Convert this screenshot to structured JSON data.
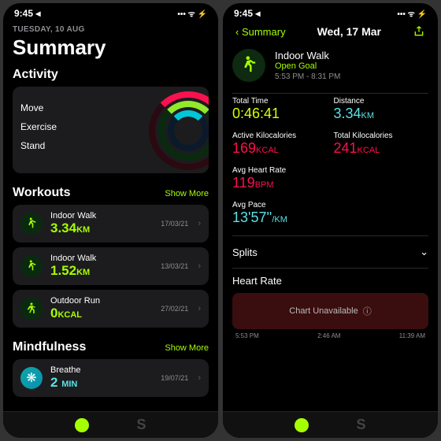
{
  "status": {
    "time": "9:45",
    "loc": "◂",
    "icons": "•••  ᯤ ⚡"
  },
  "left": {
    "date": "TUESDAY, 10 AUG",
    "title": "Summary",
    "activity": {
      "heading": "Activity",
      "labels": [
        "Move",
        "Exercise",
        "Stand"
      ]
    },
    "workouts": {
      "heading": "Workouts",
      "more": "Show More",
      "items": [
        {
          "name": "Indoor Walk",
          "val": "3.34",
          "unit": "KM",
          "date": "17/03/21"
        },
        {
          "name": "Indoor Walk",
          "val": "1.52",
          "unit": "KM",
          "date": "13/03/21"
        },
        {
          "name": "Outdoor Run",
          "val": "0",
          "unit": "KCAL",
          "date": "27/02/21"
        }
      ]
    },
    "mind": {
      "heading": "Mindfulness",
      "more": "Show More",
      "name": "Breathe",
      "val": "2",
      "unit": "MIN",
      "date": "19/07/21"
    }
  },
  "right": {
    "back": "Summary",
    "navtitle": "Wed, 17 Mar",
    "workout": {
      "name": "Indoor Walk",
      "goal": "Open Goal",
      "range": "5:53 PM - 8:31 PM"
    },
    "stats": {
      "totalTime": {
        "label": "Total Time",
        "val": "0:46:41"
      },
      "distance": {
        "label": "Distance",
        "val": "3.34",
        "unit": "KM"
      },
      "active": {
        "label": "Active Kilocalories",
        "val": "169",
        "unit": "KCAL"
      },
      "total": {
        "label": "Total Kilocalories",
        "val": "241",
        "unit": "KCAL"
      },
      "hr": {
        "label": "Avg Heart Rate",
        "val": "119",
        "unit": "BPM"
      },
      "pace": {
        "label": "Avg Pace",
        "val": "13'57''",
        "unit": "/KM"
      }
    },
    "splits": "Splits",
    "heartrate": "Heart Rate",
    "chart": "Chart Unavailable",
    "timeline": [
      "5:53 PM",
      "2:46 AM",
      "11:39 AM"
    ]
  }
}
